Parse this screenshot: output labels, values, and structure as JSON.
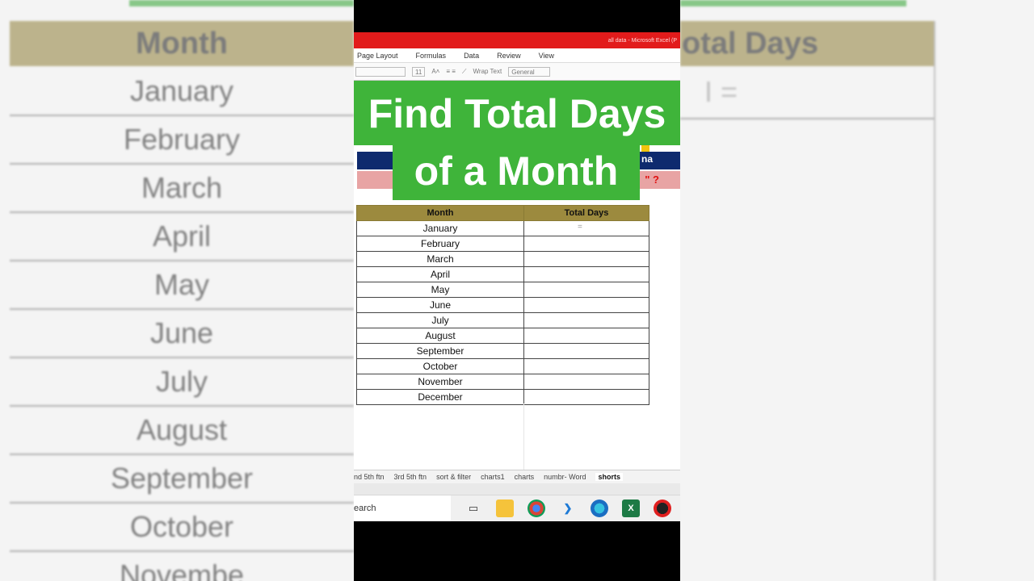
{
  "title_overlay": {
    "line1": "Find Total Days",
    "line2": "of a Month"
  },
  "window": {
    "title": "all data - Microsoft Excel (P"
  },
  "ribbon": {
    "tabs": [
      "Page Layout",
      "Formulas",
      "Data",
      "Review",
      "View"
    ],
    "font_size": "11",
    "wrap_text": "Wrap Text",
    "number_format": "General"
  },
  "banner": {
    "text": "na",
    "question": "\" ?"
  },
  "table": {
    "headers": [
      "Month",
      "Total Days"
    ],
    "rows": [
      "January",
      "February",
      "March",
      "April",
      "May",
      "June",
      "July",
      "August",
      "September",
      "October",
      "November",
      "December"
    ],
    "active_cell_text": "="
  },
  "sheet_tabs": [
    "nd 5th ftn",
    "3rd 5th ftn",
    "sort & filter",
    "charts1",
    "charts",
    "numbr- Word",
    "shorts"
  ],
  "active_sheet": "shorts",
  "taskbar": {
    "search_text": "earch"
  },
  "background": {
    "left_header": "Month",
    "left_rows": [
      "January",
      "February",
      "March",
      "April",
      "May",
      "June",
      "July",
      "August",
      "September",
      "October",
      "Novembe"
    ],
    "right_header": "otal Days",
    "right_cell": "I ="
  },
  "colors": {
    "overlay_green": "#3fb43a",
    "header_gold": "#9c8a3e",
    "titlebar_red": "#e21b1b",
    "banner_navy": "#0e2a6e"
  }
}
